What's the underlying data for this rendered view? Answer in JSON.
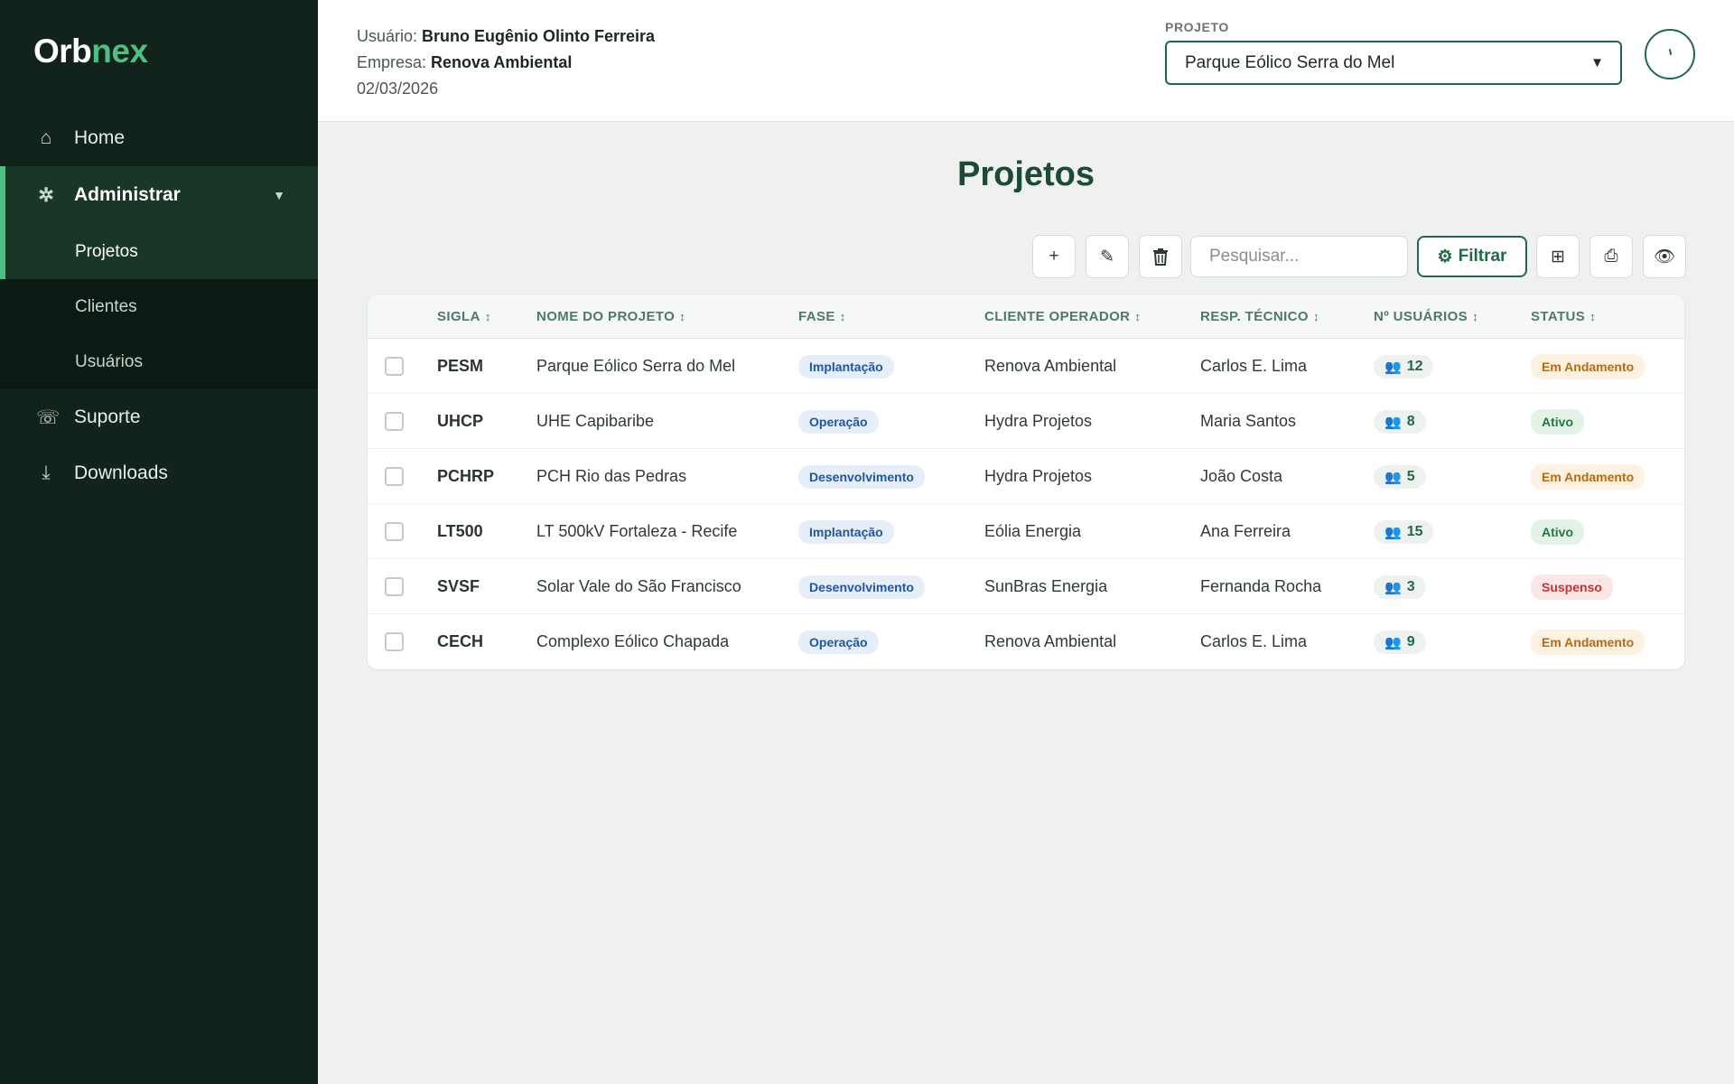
{
  "app": {
    "logo_part1": "Orb",
    "logo_part2": "nex"
  },
  "sidebar": {
    "items": [
      {
        "label": "Home",
        "icon": "home-icon",
        "glyph": "⌂"
      },
      {
        "label": "Administrar",
        "icon": "admin-gear-icon",
        "glyph": "✲",
        "expanded": true
      },
      {
        "label": "Suporte",
        "icon": "phone-icon",
        "glyph": "☏"
      },
      {
        "label": "Downloads",
        "icon": "download-icon",
        "glyph": "⤓"
      }
    ],
    "subitems": [
      {
        "label": "Projetos",
        "active": true
      },
      {
        "label": "Clientes"
      },
      {
        "label": "Usuários"
      }
    ]
  },
  "header": {
    "user_label": "Usuário:",
    "user_name": "Bruno Eugênio Olinto Ferreira",
    "company_label": "Empresa:",
    "company_name": "Renova Ambiental",
    "date": "02/03/2026",
    "project_label": "PROJETO",
    "project_selected": "Parque Eólico Serra do Mel"
  },
  "main": {
    "title": "Projetos",
    "search_placeholder": "Pesquisar...",
    "filter_label": "Filtrar",
    "columns": [
      "SIGLA",
      "NOME DO PROJETO",
      "FASE",
      "CLIENTE OPERADOR",
      "RESP. TÉCNICO",
      "Nº USUÁRIOS",
      "STATUS"
    ],
    "rows": [
      {
        "sigla": "PESM",
        "nome": "Parque Eólico Serra do Mel",
        "fase": "Implantação",
        "cliente": "Renova Ambiental",
        "resp": "Carlos E. Lima",
        "usuarios": "12",
        "status": "Em Andamento",
        "status_kind": "andamento"
      },
      {
        "sigla": "UHCP",
        "nome": "UHE Capibaribe",
        "fase": "Operação",
        "cliente": "Hydra Projetos",
        "resp": "Maria Santos",
        "usuarios": "8",
        "status": "Ativo",
        "status_kind": "ativo"
      },
      {
        "sigla": "PCHRP",
        "nome": "PCH Rio das Pedras",
        "fase": "Desenvolvimento",
        "cliente": "Hydra Projetos",
        "resp": "João Costa",
        "usuarios": "5",
        "status": "Em Andamento",
        "status_kind": "andamento"
      },
      {
        "sigla": "LT500",
        "nome": "LT 500kV Fortaleza - Recife",
        "fase": "Implantação",
        "cliente": "Eólia Energia",
        "resp": "Ana Ferreira",
        "usuarios": "15",
        "status": "Ativo",
        "status_kind": "ativo"
      },
      {
        "sigla": "SVSF",
        "nome": "Solar Vale do São Francisco",
        "fase": "Desenvolvimento",
        "cliente": "SunBras Energia",
        "resp": "Fernanda Rocha",
        "usuarios": "3",
        "status": "Suspenso",
        "status_kind": "suspenso"
      },
      {
        "sigla": "CECH",
        "nome": "Complexo Eólico Chapada",
        "fase": "Operação",
        "cliente": "Renova Ambiental",
        "resp": "Carlos E. Lima",
        "usuarios": "9",
        "status": "Em Andamento",
        "status_kind": "andamento"
      }
    ]
  },
  "colors": {
    "sidebar_bg": "#11231a",
    "accent": "#4cbf82",
    "primary": "#1f6a45",
    "title": "#1c4b33"
  }
}
